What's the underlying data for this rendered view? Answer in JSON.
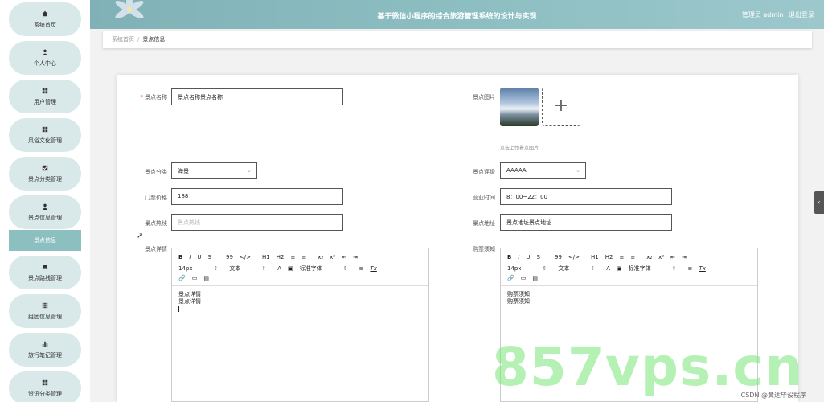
{
  "header": {
    "title": "基于微信小程序的综合旅游管理系统的设计与实现",
    "user_label": "管理员 admin",
    "logout": "退出登录"
  },
  "sidebar": {
    "items": [
      {
        "label": "系统首页",
        "icon": "home-icon"
      },
      {
        "label": "个人中心",
        "icon": "person-icon"
      },
      {
        "label": "用户管理",
        "icon": "grid-icon"
      },
      {
        "label": "风俗文化管理",
        "icon": "grid-icon"
      },
      {
        "label": "景点分类管理",
        "icon": "check-icon"
      },
      {
        "label": "景点信息管理",
        "icon": "person-icon"
      },
      {
        "label": "景点路线管理",
        "icon": "laptop-icon"
      },
      {
        "label": "组团信息管理",
        "icon": "grid-icon"
      },
      {
        "label": "旅行笔记管理",
        "icon": "bar-chart-icon"
      },
      {
        "label": "资讯分类管理",
        "icon": "grid-icon"
      }
    ],
    "active_sub": "景点信息"
  },
  "breadcrumb": {
    "home": "系统首页",
    "separator": "/",
    "current": "景点信息"
  },
  "form": {
    "name_label": "景点名称",
    "name_value": "景点名称景点名称",
    "image_label": "景点图片",
    "image_hint": "点击上传景点图片",
    "category_label": "景点分类",
    "category_value": "海景",
    "rating_label": "景点评级",
    "rating_value": "AAAAA",
    "price_label": "门票价格",
    "price_value": "188",
    "hours_label": "营业时间",
    "hours_value": "8：00~22：00",
    "hotline_label": "景点热线",
    "hotline_placeholder": "景点热线",
    "address_label": "景点地址",
    "address_value": "景点地址景点地址",
    "detail_label": "景点详情",
    "notice_label": "购票须知"
  },
  "editor_toolbar": {
    "row1": [
      "B",
      "I",
      "U",
      "S",
      "99",
      "</>",
      "H1",
      "H2",
      "≡",
      "≡",
      "x₂",
      "x²",
      "⇤",
      "⇥"
    ],
    "font_size": "14px",
    "font_type": "文本",
    "font_family": "标准字体",
    "clear": "Tx"
  },
  "detail_editor": {
    "lines": [
      "景点详情",
      "景点详情"
    ]
  },
  "notice_editor": {
    "lines": [
      "购票须知",
      "购票须知"
    ]
  },
  "watermark": "857vps.cn",
  "csdn_text": "CSDN @黄达毕设程序"
}
